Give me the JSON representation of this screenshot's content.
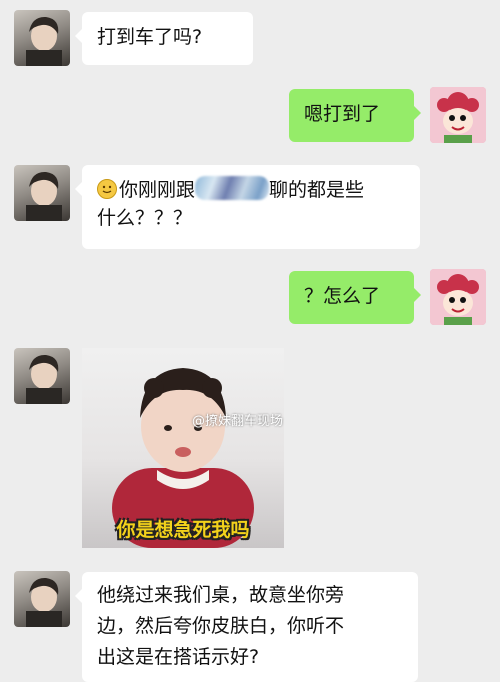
{
  "messages": [
    {
      "side": "left",
      "text": "打到车了吗?"
    },
    {
      "side": "right",
      "text": "嗯打到了"
    },
    {
      "side": "left",
      "text_before": "你刚刚跟",
      "text_after": "聊的都是些",
      "text_line2": "什么？？？"
    },
    {
      "side": "right",
      "text": "？怎么了"
    },
    {
      "side": "left",
      "sticker_caption": "你是想急死我吗",
      "sticker_watermark": "@撩妹翻车现场"
    },
    {
      "side": "left",
      "text_line1": "他绕过来我们桌，故意坐你旁",
      "text_line2": "边，然后夸你皮肤白，你听不",
      "text_line3": "出这是在搭话示好?"
    }
  ],
  "icons": {
    "emoji": "smiling-face-icon"
  }
}
